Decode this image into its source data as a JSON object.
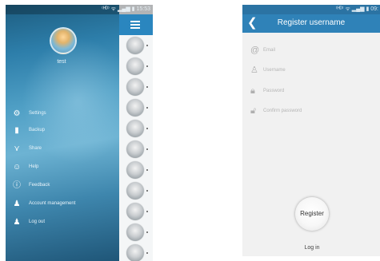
{
  "left_phone": {
    "status_bar": {
      "right": "⁽ᴴᴰ⁾ ᯤ ▂▄▆ ▮ 15:53"
    },
    "drawer": {
      "username": "test",
      "menu": [
        {
          "icon": "gear-icon",
          "glyph": "⚙",
          "label": "Settings"
        },
        {
          "icon": "backup-icon",
          "glyph": "▮",
          "label": "Backup"
        },
        {
          "icon": "share-icon",
          "glyph": "⋎",
          "label": "Share"
        },
        {
          "icon": "help-icon",
          "glyph": "☺",
          "label": "Help"
        },
        {
          "icon": "feedback-icon",
          "glyph": "ⓘ",
          "label": "Feedback"
        },
        {
          "icon": "account-icon",
          "glyph": "♟",
          "label": "Account management"
        },
        {
          "icon": "logout-icon",
          "glyph": "♟",
          "label": "Log out"
        }
      ]
    }
  },
  "right_phone": {
    "status_bar": {
      "right": "⁽ᴴᴰ⁾ ᯤ ▂▄▆ ▮ 09:"
    },
    "title": "Register username",
    "fields": [
      {
        "icon": "email-icon",
        "glyph": "@",
        "placeholder": "Email"
      },
      {
        "icon": "user-icon",
        "glyph": "♙",
        "placeholder": "Username"
      },
      {
        "icon": "lock-icon",
        "glyph": "🔒︎",
        "placeholder": "Password"
      },
      {
        "icon": "lock-open-icon",
        "glyph": "🔓︎",
        "placeholder": "Confirm password"
      }
    ],
    "register_label": "Register",
    "login_label": "Log in"
  }
}
